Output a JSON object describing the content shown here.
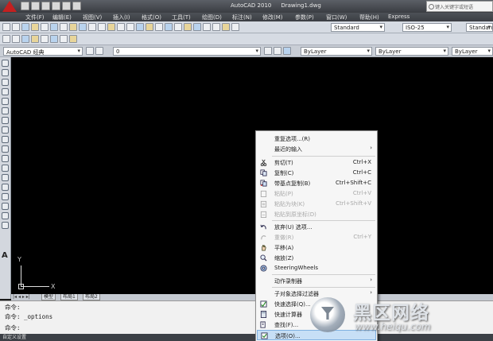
{
  "titlebar": {
    "app_name": "AutoCAD 2010",
    "document": "Drawing1.dwg",
    "search_placeholder": "键入关键字或短语"
  },
  "menu": [
    "文件(F)",
    "编辑(E)",
    "视图(V)",
    "插入(I)",
    "格式(O)",
    "工具(T)",
    "绘图(D)",
    "标注(N)",
    "修改(M)",
    "参数(P)",
    "窗口(W)",
    "帮助(H)",
    "Express"
  ],
  "toolbar": {
    "workspace": "AutoCAD 经典",
    "layer": "0",
    "text_style": "Standard",
    "dim_style": "ISO-25",
    "table_style": "Standard",
    "color": "ByLayer",
    "linetype": "ByLayer",
    "lineweight": "ByLayer"
  },
  "canvas": {
    "ucs_x": "X",
    "ucs_y": "Y"
  },
  "tabs": {
    "nav": "|◂ ◂ ▸ ▸|",
    "model": "模型",
    "layout1": "布局1",
    "layout2": "布局2"
  },
  "command": {
    "line1": "命令:",
    "line2": "命令: _options",
    "line3": "命令:",
    "status": "自定义设置"
  },
  "context_menu": {
    "items": [
      {
        "label": "重复选项...(R)"
      },
      {
        "label": "最近的输入",
        "submenu": true
      },
      {
        "label": "剪切(T)",
        "shortcut": "Ctrl+X",
        "icon": "cut-icon"
      },
      {
        "label": "复制(C)",
        "shortcut": "Ctrl+C",
        "icon": "copy-icon"
      },
      {
        "label": "带基点复制(B)",
        "shortcut": "Ctrl+Shift+C",
        "icon": "copy-base-icon"
      },
      {
        "label": "粘贴(P)",
        "shortcut": "Ctrl+V",
        "disabled": true,
        "icon": "paste-icon"
      },
      {
        "label": "粘贴为块(K)",
        "shortcut": "Ctrl+Shift+V",
        "disabled": true,
        "icon": "paste-block-icon"
      },
      {
        "label": "粘贴到原坐标(D)",
        "disabled": true,
        "icon": "paste-orig-icon"
      },
      {
        "label": "放弃(U) 选项...",
        "icon": "undo-icon"
      },
      {
        "label": "重做(R)",
        "shortcut": "Ctrl+Y",
        "disabled": true,
        "icon": "redo-icon"
      },
      {
        "label": "平移(A)",
        "icon": "pan-icon"
      },
      {
        "label": "缩放(Z)",
        "icon": "zoom-icon"
      },
      {
        "label": "SteeringWheels",
        "icon": "steeringwheels-icon"
      },
      {
        "label": "动作录制器",
        "submenu": true
      },
      {
        "label": "子对象选择过滤器",
        "submenu": true
      },
      {
        "label": "快速选择(Q)...",
        "icon": "quick-select-icon"
      },
      {
        "label": "快速计算器",
        "icon": "calculator-icon"
      },
      {
        "label": "查找(F)...",
        "icon": "find-icon"
      },
      {
        "label": "选项(O)...",
        "icon": "options-icon",
        "highlighted": true
      }
    ]
  },
  "watermark": {
    "text": "黑区网络",
    "url": "www.heiqu.com"
  }
}
